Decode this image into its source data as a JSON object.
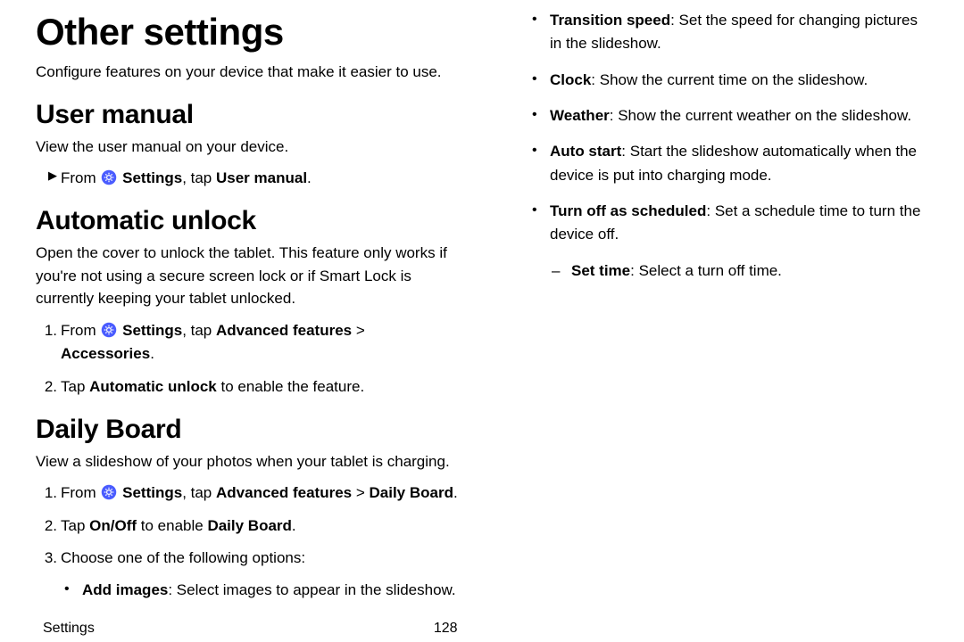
{
  "title": "Other settings",
  "intro": "Configure features on your device that make it easier to use.",
  "s1": {
    "h": "User manual",
    "p": "View the user manual on your device."
  },
  "um_pre": "From ",
  "um_mid": "Settings",
  "um_post": ", tap ",
  "um_bold": "User manual",
  "um_end": ".",
  "s2": {
    "h": "Automatic unlock",
    "p": "Open the cover to unlock the tablet. This feature only works if you're not using a secure screen lock or if Smart Lock is currently keeping your tablet unlocked."
  },
  "au1_pre": "From ",
  "au1_b1": "Settings",
  "au1_mid": ", tap ",
  "au1_b2": "Advanced features",
  "au1_sep": " > ",
  "au1_b3": "Accessories",
  "au1_end": ".",
  "au2_pre": "Tap ",
  "au2_b": "Automatic unlock",
  "au2_post": " to enable the feature.",
  "s3": {
    "h": "Daily Board",
    "p": "View a slideshow of your photos when your tablet is charging."
  },
  "db1_pre": "From ",
  "db1_b1": "Settings",
  "db1_mid": ", tap ",
  "db1_b2": "Advanced features",
  "db1_sep": " > ",
  "db1_b3": "Daily Board",
  "db1_end": ".",
  "db2_pre": "Tap ",
  "db2_b1": "On/Off",
  "db2_mid": " to enable ",
  "db2_b2": "Daily Board",
  "db2_end": ".",
  "db3": "Choose one of the following options:",
  "opt1_b": "Add images",
  "opt1_t": ": Select images to appear in the slideshow.",
  "opt2_b": "Transition speed",
  "opt2_t": ": Set the speed for changing pictures in the slideshow.",
  "opt3_b": "Clock",
  "opt3_t": ": Show the current time on the slideshow.",
  "opt4_b": "Weather",
  "opt4_t": ": Show the current weather on the slideshow.",
  "opt5_b": "Auto start",
  "opt5_t": ": Start the slideshow automatically when the device is put into charging mode.",
  "opt6_b": "Turn off as scheduled",
  "opt6_t": ": Set a schedule time to turn the device off.",
  "opt6s_b": "Set time",
  "opt6s_t": ": Select a turn off time.",
  "footer_section": "Settings",
  "footer_page": "128"
}
